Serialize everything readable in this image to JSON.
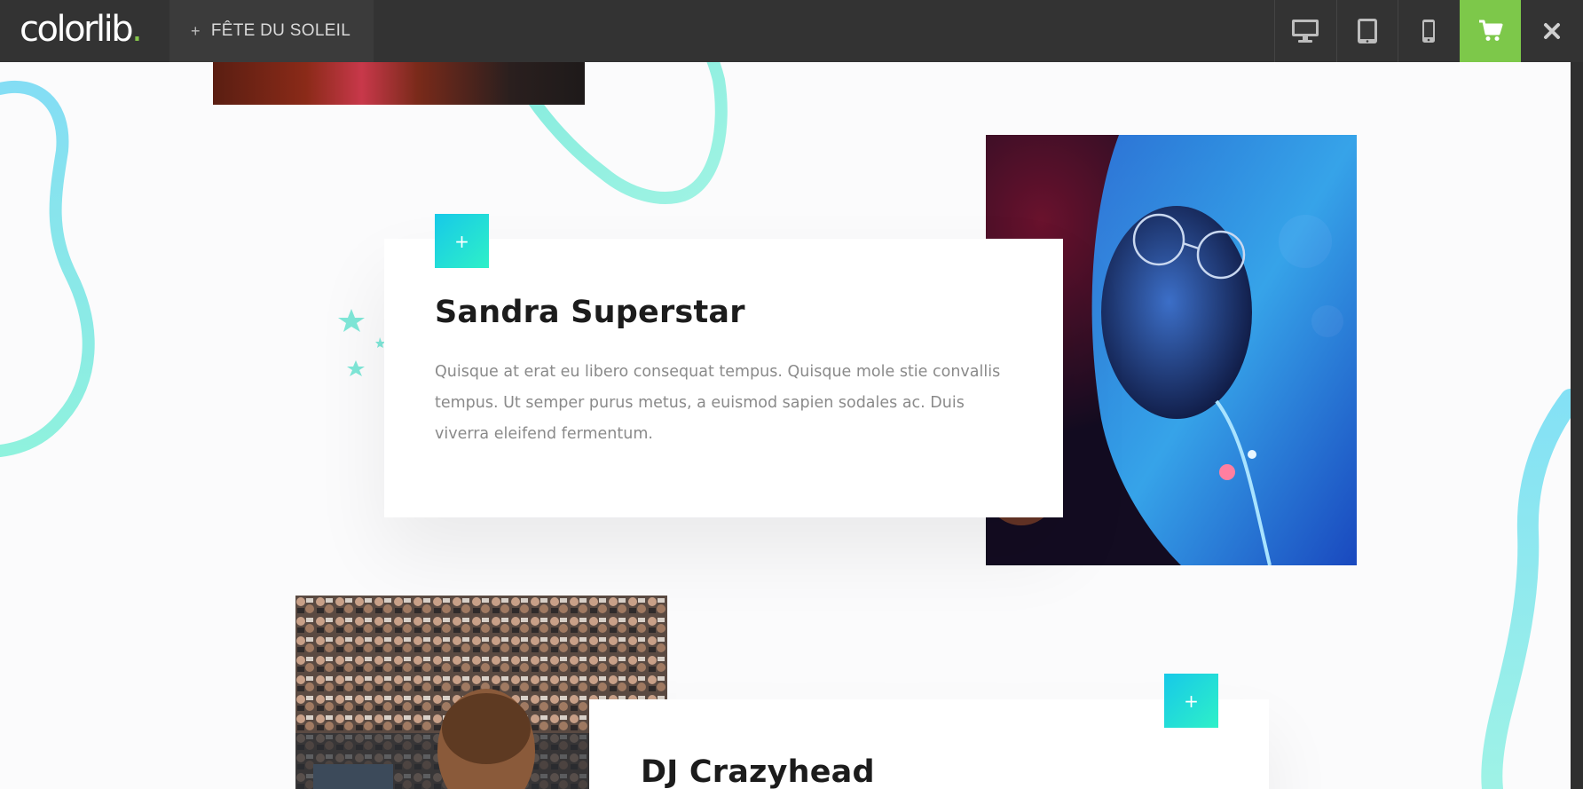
{
  "topbar": {
    "logo_text": "colorlib",
    "logo_dot": ".",
    "theme_plus": "+",
    "theme_name": "FÊTE DU SOLEIL",
    "devices": [
      "desktop-icon",
      "tablet-icon",
      "mobile-icon"
    ],
    "cart_icon": "cart-icon",
    "close_icon": "close-icon",
    "cart_color": "#7dc84a"
  },
  "artists": [
    {
      "plus": "+",
      "name": "Sandra Superstar",
      "description": "Quisque at erat eu libero consequat tempus. Quisque mole stie convallis tempus. Ut semper purus metus, a euismod sapien sodales ac. Duis viverra eleifend fermentum."
    },
    {
      "plus": "+",
      "name": "DJ Crazyhead"
    }
  ],
  "accent_gradient": [
    "#17c9e8",
    "#2ef0c8"
  ]
}
